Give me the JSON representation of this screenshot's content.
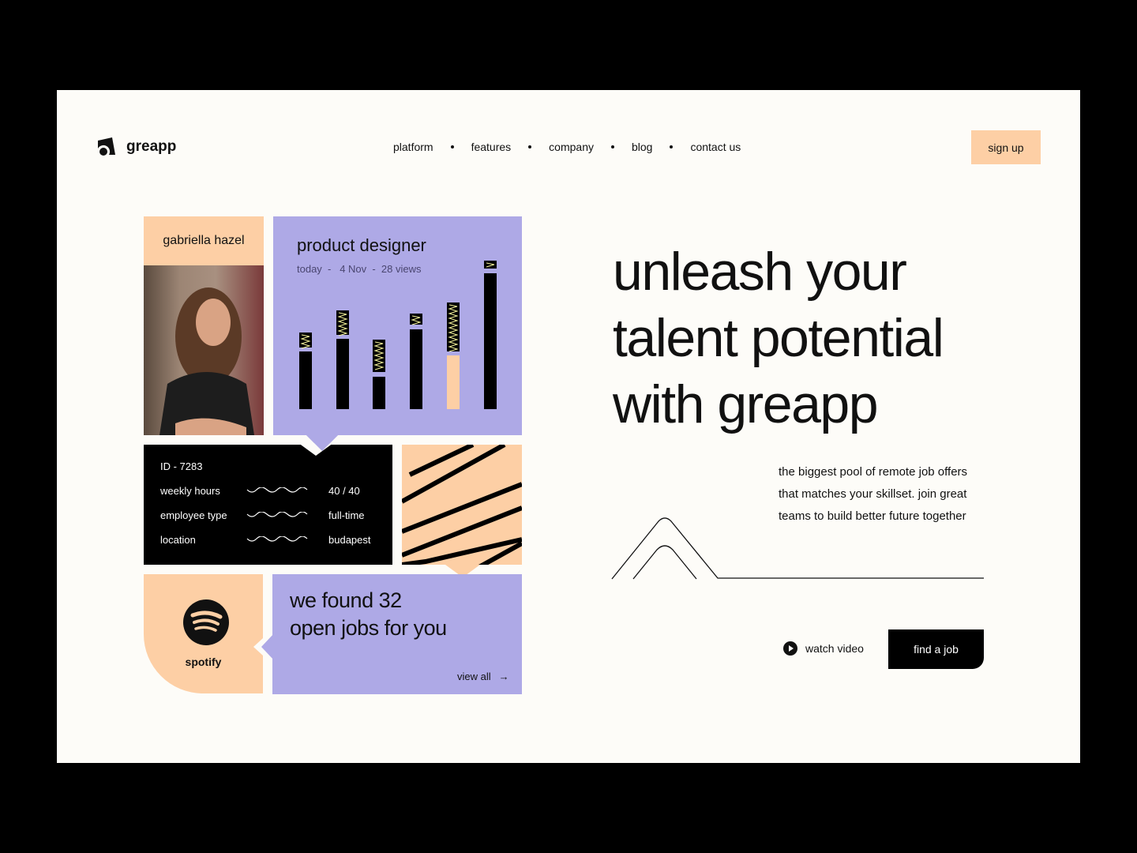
{
  "brand": {
    "name": "greapp"
  },
  "nav": {
    "items": [
      "platform",
      "features",
      "company",
      "blog",
      "contact us"
    ],
    "signup": "sign up"
  },
  "profile": {
    "name": "gabriella hazel"
  },
  "job": {
    "title": "product designer",
    "meta": "today  -   4 Nov  -  28 views"
  },
  "details": {
    "id": "ID - 7283",
    "rows": [
      {
        "label": "weekly hours",
        "value": "40 / 40"
      },
      {
        "label": "employee type",
        "value": "full-time"
      },
      {
        "label": "location",
        "value": "budapest"
      }
    ]
  },
  "company": {
    "name": "spotify",
    "icon": "spotify-icon"
  },
  "jobs": {
    "line1": "we found 32",
    "line2": "open jobs for you",
    "view_all": "view all"
  },
  "hero": {
    "line1": "unleash your",
    "line2": "talent potential",
    "line3": "with greapp",
    "description": [
      "the biggest pool of remote job offers",
      "that matches your skillset. join great",
      "teams to build better future together"
    ]
  },
  "cta": {
    "watch": "watch video",
    "find": "find a job"
  },
  "colors": {
    "peach": "#fdcfa5",
    "purple": "#aea9e6",
    "cream": "#fdfcf8",
    "black": "#000000"
  }
}
